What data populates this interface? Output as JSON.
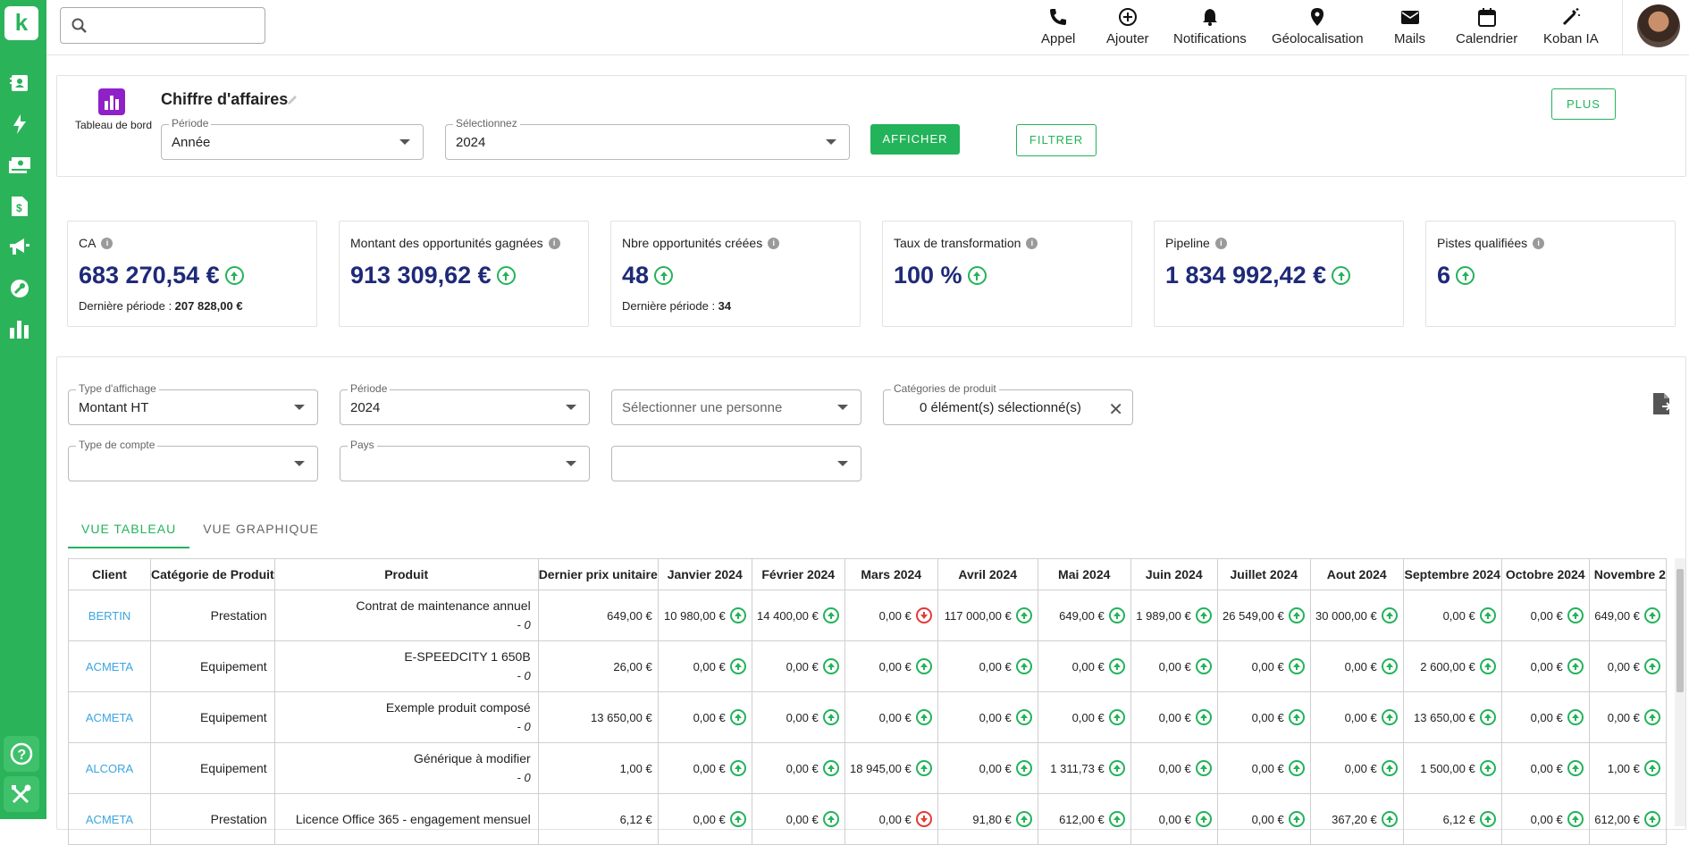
{
  "app": {
    "logo_letter": "k",
    "accent": "#2bb35a",
    "sidebar_icons": [
      "contacts-icon",
      "lightning-icon",
      "cash-icon",
      "invoice-icon",
      "megaphone-icon",
      "wrench-icon",
      "bar-chart-icon"
    ],
    "sidebar_bottom_icons": [
      "help-icon",
      "tools-icon"
    ]
  },
  "search": {
    "placeholder": ""
  },
  "topnav": [
    {
      "label": "Appel",
      "icon": "phone-icon"
    },
    {
      "label": "Ajouter",
      "icon": "add-circle-icon"
    },
    {
      "label": "Notifications",
      "icon": "bell-icon"
    },
    {
      "label": "Géolocalisation",
      "icon": "map-pin-icon"
    },
    {
      "label": "Mails",
      "icon": "mail-icon"
    },
    {
      "label": "Calendrier",
      "icon": "calendar-icon"
    },
    {
      "label": "Koban IA",
      "icon": "magic-wand-icon"
    }
  ],
  "header": {
    "dashboard_label": "Tableau de bord",
    "title": "Chiffre d'affaires",
    "periode_label": "Période",
    "periode_value": "Année",
    "select_label": "Sélectionnez",
    "select_value": "2024",
    "afficher": "AFFICHER",
    "filtrer": "FILTRER",
    "plus": "PLUS"
  },
  "kpis": [
    {
      "label": "CA",
      "value": "683 270,54 €",
      "sub_label": "Dernière période : ",
      "sub_value": "207 828,00 €"
    },
    {
      "label": "Montant des opportunités gagnées",
      "value": "913 309,62 €",
      "sub_label": "",
      "sub_value": ""
    },
    {
      "label": "Nbre opportunités créées",
      "value": "48",
      "sub_label": "Dernière période : ",
      "sub_value": "34"
    },
    {
      "label": "Taux de transformation",
      "value": "100 %",
      "sub_label": "",
      "sub_value": ""
    },
    {
      "label": "Pipeline",
      "value": "1 834 992,42 €",
      "sub_label": "",
      "sub_value": ""
    },
    {
      "label": "Pistes qualifiées",
      "value": "6",
      "sub_label": "",
      "sub_value": ""
    }
  ],
  "filters": {
    "type_affichage_label": "Type d'affichage",
    "type_affichage_value": "Montant HT",
    "periode_label": "Période",
    "periode_value": "2024",
    "personne_placeholder": "Sélectionner une personne",
    "categories_label": "Catégories de produit",
    "categories_value": "0 élément(s) sélectionné(s)",
    "type_compte_label": "Type de compte",
    "type_compte_value": "",
    "pays_label": "Pays",
    "pays_value": "",
    "extra_value": ""
  },
  "tabs": [
    "VUE TABLEAU",
    "VUE GRAPHIQUE"
  ],
  "table": {
    "headers": [
      "Client",
      "Catégorie de Produit",
      "Produit",
      "Dernier prix unitaire",
      "Janvier 2024",
      "Février 2024",
      "Mars 2024",
      "Avril 2024",
      "Mai 2024",
      "Juin 2024",
      "Juillet 2024",
      "Aout 2024",
      "Septembre 2024",
      "Octobre 2024",
      "Novembre 2"
    ],
    "rows": [
      {
        "client": "BERTIN",
        "cat": "Prestation",
        "prod": "Contrat de maintenance annuel",
        "prod_sub": "- 0",
        "price": "649,00 €",
        "months": [
          [
            "10 980,00 €",
            "up"
          ],
          [
            "14 400,00 €",
            "up"
          ],
          [
            "0,00 €",
            "down"
          ],
          [
            "117 000,00 €",
            "up"
          ],
          [
            "649,00 €",
            "up"
          ],
          [
            "1 989,00 €",
            "up"
          ],
          [
            "26 549,00 €",
            "up"
          ],
          [
            "30 000,00 €",
            "up"
          ],
          [
            "0,00 €",
            "up"
          ],
          [
            "0,00 €",
            "up"
          ],
          [
            "649,00 €",
            "up"
          ]
        ]
      },
      {
        "client": "ACMETA",
        "cat": "Equipement",
        "prod": "E-SPEEDCITY 1 650B",
        "prod_sub": "- 0",
        "price": "26,00 €",
        "months": [
          [
            "0,00 €",
            "up"
          ],
          [
            "0,00 €",
            "up"
          ],
          [
            "0,00 €",
            "up"
          ],
          [
            "0,00 €",
            "up"
          ],
          [
            "0,00 €",
            "up"
          ],
          [
            "0,00 €",
            "up"
          ],
          [
            "0,00 €",
            "up"
          ],
          [
            "0,00 €",
            "up"
          ],
          [
            "2 600,00 €",
            "up"
          ],
          [
            "0,00 €",
            "up"
          ],
          [
            "0,00 €",
            "up"
          ]
        ]
      },
      {
        "client": "ACMETA",
        "cat": "Equipement",
        "prod": "Exemple produit composé",
        "prod_sub": "- 0",
        "price": "13 650,00 €",
        "months": [
          [
            "0,00 €",
            "up"
          ],
          [
            "0,00 €",
            "up"
          ],
          [
            "0,00 €",
            "up"
          ],
          [
            "0,00 €",
            "up"
          ],
          [
            "0,00 €",
            "up"
          ],
          [
            "0,00 €",
            "up"
          ],
          [
            "0,00 €",
            "up"
          ],
          [
            "0,00 €",
            "up"
          ],
          [
            "13 650,00 €",
            "up"
          ],
          [
            "0,00 €",
            "up"
          ],
          [
            "0,00 €",
            "up"
          ]
        ]
      },
      {
        "client": "ALCORA",
        "cat": "Equipement",
        "prod": "Générique à modifier",
        "prod_sub": "- 0",
        "price": "1,00 €",
        "months": [
          [
            "0,00 €",
            "up"
          ],
          [
            "0,00 €",
            "up"
          ],
          [
            "18 945,00 €",
            "up"
          ],
          [
            "0,00 €",
            "up"
          ],
          [
            "1 311,73 €",
            "up"
          ],
          [
            "0,00 €",
            "up"
          ],
          [
            "0,00 €",
            "up"
          ],
          [
            "0,00 €",
            "up"
          ],
          [
            "1 500,00 €",
            "up"
          ],
          [
            "0,00 €",
            "up"
          ],
          [
            "1,00 €",
            "up"
          ]
        ]
      },
      {
        "client": "ACMETA",
        "cat": "Prestation",
        "prod": "Licence Office 365 - engagement mensuel",
        "prod_sub": "",
        "price": "6,12 €",
        "months": [
          [
            "0,00 €",
            "up"
          ],
          [
            "0,00 €",
            "up"
          ],
          [
            "0,00 €",
            "down"
          ],
          [
            "91,80 €",
            "up"
          ],
          [
            "612,00 €",
            "up"
          ],
          [
            "0,00 €",
            "up"
          ],
          [
            "0,00 €",
            "up"
          ],
          [
            "367,20 €",
            "up"
          ],
          [
            "6,12 €",
            "up"
          ],
          [
            "0,00 €",
            "up"
          ],
          [
            "612,00 €",
            "up"
          ]
        ]
      }
    ]
  }
}
